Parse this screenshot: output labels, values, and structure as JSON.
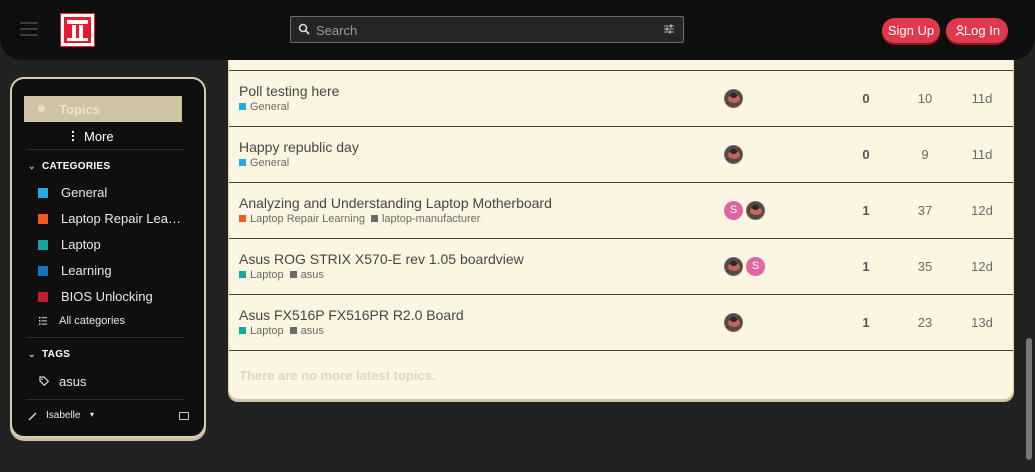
{
  "header": {
    "search_placeholder": "Search",
    "signup_label": "Sign Up",
    "login_label": "Log In"
  },
  "sidebar": {
    "topics_label": "Topics",
    "more_label": "More",
    "categories_heading": "CATEGORIES",
    "categories": [
      {
        "label": "General",
        "color": "#25aae2"
      },
      {
        "label": "Laptop Repair Lea…",
        "color": "#f15a22"
      },
      {
        "label": "Laptop",
        "color": "#12a89d"
      },
      {
        "label": "Learning",
        "color": "#0e76bd"
      },
      {
        "label": "BIOS Unlocking",
        "color": "#bf1e2e"
      }
    ],
    "all_categories_label": "All categories",
    "tags_heading": "TAGS",
    "tags": [
      {
        "label": "asus"
      }
    ],
    "footer_user": "Isabelle"
  },
  "topics": [
    {
      "title": "Poll testing here",
      "category": {
        "label": "General",
        "color": "#25aae2"
      },
      "tags": [],
      "posters": [
        "avatar"
      ],
      "replies": "0",
      "views": "10",
      "activity": "11d"
    },
    {
      "title": "Happy republic day",
      "category": {
        "label": "General",
        "color": "#25aae2"
      },
      "tags": [],
      "posters": [
        "avatar"
      ],
      "replies": "0",
      "views": "9",
      "activity": "11d"
    },
    {
      "title": "Analyzing and Understanding Laptop Motherboard",
      "category": {
        "label": "Laptop Repair Learning",
        "color": "#f15a22"
      },
      "tags": [
        "laptop-manufacturer"
      ],
      "posters": [
        "S",
        "avatar"
      ],
      "replies": "1",
      "views": "37",
      "activity": "12d"
    },
    {
      "title": "Asus ROG STRIX X570-E rev 1.05 boardview",
      "category": {
        "label": "Laptop",
        "color": "#12a89d"
      },
      "tags": [
        "asus"
      ],
      "posters": [
        "avatar",
        "S"
      ],
      "replies": "1",
      "views": "35",
      "activity": "12d"
    },
    {
      "title": "Asus FX516P FX516PR R2.0 Board",
      "category": {
        "label": "Laptop",
        "color": "#12a89d"
      },
      "tags": [
        "asus"
      ],
      "posters": [
        "avatar"
      ],
      "replies": "1",
      "views": "23",
      "activity": "13d"
    }
  ],
  "no_more_label": "There are no more latest topics."
}
